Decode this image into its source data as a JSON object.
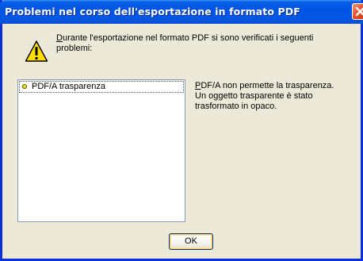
{
  "dialog": {
    "title": "Problemi nel corso dell'esportazione in formato PDF",
    "message_line1": "Durante l'esportazione nel formato PDF si sono verificati i seguenti",
    "message_line2": "problemi:",
    "ok_label": "OK"
  },
  "problems": {
    "items": [
      {
        "label": "PDF/A trasparenza"
      }
    ]
  },
  "details": {
    "line1": "PDF/A non permette la trasparenza.",
    "line2": "Un oggetto trasparente è stato",
    "line3": "trasformato in opaco."
  },
  "icons": {
    "warning": "warning-icon",
    "close": "close-icon",
    "bullet": "bullet-icon"
  },
  "colors": {
    "titlebar": "#0054e3",
    "window_bg": "#ece9d8",
    "close_button": "#e5502a",
    "warning_fill": "#ffde00"
  }
}
